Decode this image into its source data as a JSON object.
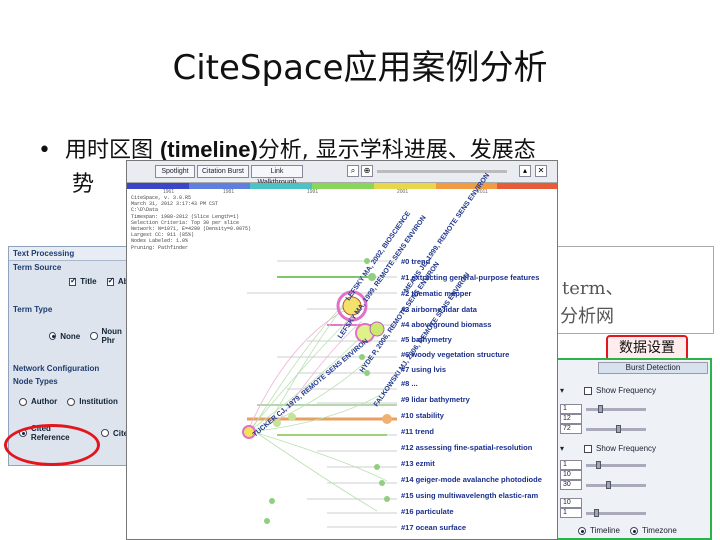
{
  "slide": {
    "title": "CiteSpace应用案例分析",
    "bullet_prefix": "用时区图 ",
    "bullet_bold": "(timeline)",
    "bullet_rest": "分析, 显示学科进展、发展态",
    "bullet_cont": "势"
  },
  "left_panel": {
    "header": "Text Processing",
    "term_source": "Term Source",
    "title_cb": "Title",
    "abstract_cb": "Abs",
    "term_type": "Term Type",
    "none_rb": "None",
    "noun_rb": "Noun Phr",
    "network_config": "Network Configuration",
    "node_types": "Node Types",
    "author": "Author",
    "institution": "Institution",
    "cited_reference": "Cited Reference",
    "cited_more": "Cited"
  },
  "right_panel": {
    "term_text": "term、",
    "network_text": "分析网",
    "button_label": "数据设置",
    "burst_tab": "Burst Detection",
    "show_frequency_1": "Show Frequency",
    "show_frequency_2": "Show Frequency",
    "inputs": [
      "1",
      "12",
      "72",
      "1",
      "10",
      "30",
      "10",
      "1"
    ],
    "timeline": "Timeline",
    "timezone": "Timezone"
  },
  "viz": {
    "tabs": [
      "Spotlight",
      "Citation Burst",
      "Link Walkthrough"
    ],
    "years": [
      "1961",
      "1981",
      "1991",
      "2001",
      "2011"
    ],
    "info_lines": [
      "CiteSpace, v. 3.0.R5",
      "March 31, 2012 3:17:43 PM CST",
      "C:\\D\\Data",
      "Timespan: 1988-2012 (Slice Length=1)",
      "Selection Criteria: Top 30 per slice",
      "Network: N=1071, E=4299 (Density=0.0075)",
      "Largest CC: 911 (85%)",
      "Nodes Labeled: 1.0%",
      "Pruning: Pathfinder"
    ],
    "clusters": [
      "#0 trend",
      "#1 extracting general-purpose features",
      "#2 thematic mapper",
      "#3 airborne lidar data",
      "#4 aboveground biomass",
      "#5 bathymetry",
      "#6 woody vegetation structure",
      "#7 using lvis",
      "#8 ...",
      "#9 lidar bathymetry",
      "#10 stability",
      "#11 trend",
      "#12 assessing fine-spatial-resolution",
      "#13 ezmit",
      "#14 geiger-mode avalanche photodiode",
      "#15 using multiwavelength elastic-ram",
      "#16 particulate",
      "#17 ocean surface"
    ],
    "node_labels": [
      "TUCKER CJ, 1979, REMOTE SENS ENVIRON",
      "LEFSKY MA, 2002, BIOSCIENCE",
      "LEFSKY MA, 1999, REMOTE SENS ENVIRON",
      "HYDE P, 2006, REMOTE SENS ENVIRON",
      "FALKOWSKI MJ, 2006, REMOTE SENS ENVIRON",
      "MEANS JE, 1999, REMOTE SENS ENVIRON"
    ]
  },
  "colors": {
    "accent_red": "#e3161d",
    "panel_green": "#2bb34a",
    "cluster_text": "#1a2f8c"
  }
}
